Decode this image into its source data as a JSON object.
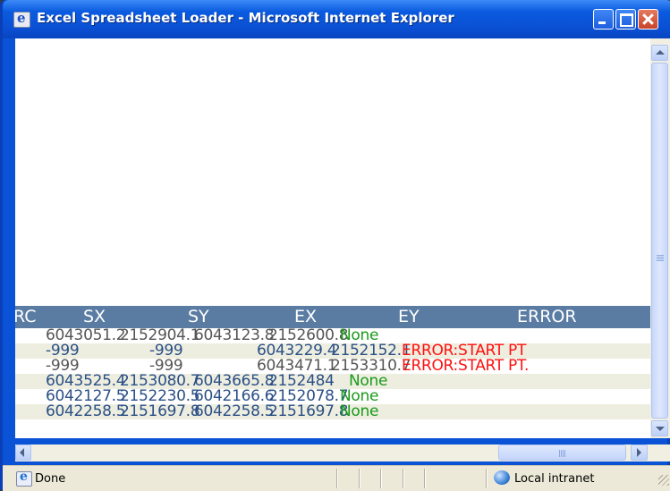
{
  "window": {
    "title": "Excel Spreadsheet Loader - Microsoft Internet Explorer"
  },
  "grid": {
    "columns": [
      "RC",
      "SX",
      "SY",
      "EX",
      "EY",
      "ERROR"
    ],
    "rows": [
      {
        "sx": "6043051.2",
        "sy": "2152904.1",
        "ex": "6043123.8",
        "ey": "2152600.8",
        "error": "None",
        "status": "ok"
      },
      {
        "sx": "-999",
        "sy": "-999",
        "ex": "6043229.4",
        "ey": "2152152.1",
        "error": "ERROR:START  PT",
        "status": "error"
      },
      {
        "sx": "-999",
        "sy": "-999",
        "ex": "6043471.1",
        "ey": "2153310.7",
        "error": "ERROR:START  PT.",
        "status": "error"
      },
      {
        "sx": "6043525.4",
        "sy": "2153080.7",
        "ex": "6043665.8",
        "ey": "2152484",
        "error": "None",
        "status": "ok"
      },
      {
        "sx": "6042127.5",
        "sy": "2152230.5",
        "ex": "6042166.6",
        "ey": "2152078.7",
        "error": "None",
        "status": "ok"
      },
      {
        "sx": "6042258.5",
        "sy": "2151697.8",
        "ex": "6042258.5",
        "ey": "2151697.8",
        "error": "None",
        "status": "ok"
      }
    ]
  },
  "statusbar": {
    "status_text": "Done",
    "zone_text": "Local intranet"
  },
  "colors": {
    "titlebar": "#0a5be0",
    "grid_header": "#5a7ca3",
    "ok_text": "#1a9a1a",
    "error_text": "#ff1010",
    "value_gray": "#555555",
    "value_blue": "#2a4f86"
  },
  "icons": [
    "ie-page-icon",
    "minimize-icon",
    "maximize-icon",
    "close-icon",
    "scroll-up-icon",
    "scroll-down-icon",
    "scroll-left-icon",
    "scroll-right-icon",
    "globe-zone-icon"
  ]
}
